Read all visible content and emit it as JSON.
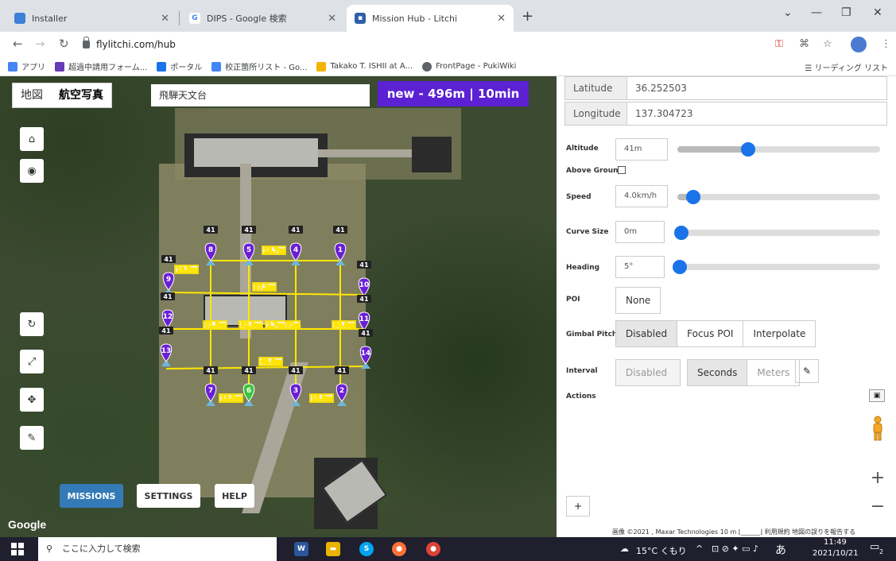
{
  "browser": {
    "tabs": [
      {
        "title": "Installer",
        "active": false
      },
      {
        "title": "DIPS - Google 検索",
        "active": false
      },
      {
        "title": "Mission Hub - Litchi",
        "active": true
      }
    ],
    "url": "flylitchi.com/hub",
    "bookmarks": [
      {
        "label": "アプリ",
        "color": "#4285f4"
      },
      {
        "label": "超過中請用フォーム...",
        "color": "#673ab7"
      },
      {
        "label": "ポータル",
        "color": "#1a73e8"
      },
      {
        "label": "校正箇所リスト - Go...",
        "color": "#4285f4"
      },
      {
        "label": "Takako T. ISHII at A...",
        "color": "#f4b400"
      },
      {
        "label": "FrontPage - PukiWiki",
        "color": "#5f6368"
      }
    ],
    "reading_list": "リーディング リスト"
  },
  "map": {
    "map_type": {
      "map": "地図",
      "satellite": "航空写真"
    },
    "search_value": "飛騨天文台",
    "mission_badge": "new - 496m | 10min",
    "waypoints": [
      {
        "n": "1",
        "alt": "41",
        "color": "#6a1fd6"
      },
      {
        "n": "2",
        "alt": "41",
        "color": "#6a1fd6"
      },
      {
        "n": "3",
        "alt": "41",
        "color": "#6a1fd6"
      },
      {
        "n": "4",
        "alt": "41",
        "color": "#6a1fd6"
      },
      {
        "n": "5",
        "alt": "41",
        "color": "#6a1fd6"
      },
      {
        "n": "6",
        "alt": "41",
        "color": "#3cc43c"
      },
      {
        "n": "7",
        "alt": "41",
        "color": "#6a1fd6"
      },
      {
        "n": "8",
        "alt": "41",
        "color": "#6a1fd6"
      },
      {
        "n": "9",
        "alt": "41",
        "color": "#6a1fd6"
      },
      {
        "n": "10",
        "alt": "41",
        "color": "#6a1fd6"
      },
      {
        "n": "11",
        "alt": "41",
        "color": "#6a1fd6"
      },
      {
        "n": "12",
        "alt": "41",
        "color": "#6a1fd6"
      },
      {
        "n": "13",
        "alt": "41",
        "color": "#6a1fd6"
      },
      {
        "n": "14",
        "alt": "41",
        "color": "#6a1fd6"
      }
    ],
    "distances": [
      "15.7m",
      "18.5m",
      "57.2m",
      "51.5m",
      "52.3m",
      "2.7m",
      "51m",
      "50.6m",
      "68.6m",
      "13.5m",
      "15.9m"
    ],
    "bottom_buttons": {
      "missions": "MISSIONS",
      "settings": "SETTINGS",
      "help": "HELP"
    },
    "logo": "Google"
  },
  "panel": {
    "latitude": {
      "label": "Latitude",
      "value": "36.252503"
    },
    "longitude": {
      "label": "Longitude",
      "value": "137.304723"
    },
    "altitude": {
      "label": "Altitude",
      "value": "41m",
      "level": 0.35
    },
    "above_ground": {
      "label": "Above Ground",
      "checked": false
    },
    "speed": {
      "label": "Speed",
      "value": "4.0km/h",
      "level": 0.08
    },
    "curve_size": {
      "label": "Curve Size",
      "value": "0m",
      "level": 0.0
    },
    "heading": {
      "label": "Heading",
      "value": "5°",
      "level": 0.02
    },
    "poi": {
      "label": "POI",
      "value": "None"
    },
    "gimbal_pitch": {
      "label": "Gimbal Pitch",
      "options": [
        "Disabled",
        "Focus POI",
        "Interpolate"
      ],
      "selected": "Disabled"
    },
    "interval": {
      "label": "Interval",
      "value": "Disabled",
      "modes": [
        "Seconds",
        "Meters"
      ],
      "selected": "Seconds"
    },
    "actions_label": "Actions",
    "attribution": "画像 ©2021 , Maxar Technologies   10 m ⌊______⌋   利用規約   地図の誤りを報告する"
  },
  "taskbar": {
    "search_placeholder": "ここに入力して検索",
    "weather": "15°C くもり",
    "ime": "あ",
    "time": "11:49",
    "date": "2021/10/21",
    "notifications": "2"
  },
  "colors": {
    "accent": "#1a73e8",
    "mission_purple": "#5b21d3",
    "missions_button": "#337ab7",
    "waypoint_purple": "#6a1fd6",
    "waypoint_green": "#3cc43c"
  }
}
